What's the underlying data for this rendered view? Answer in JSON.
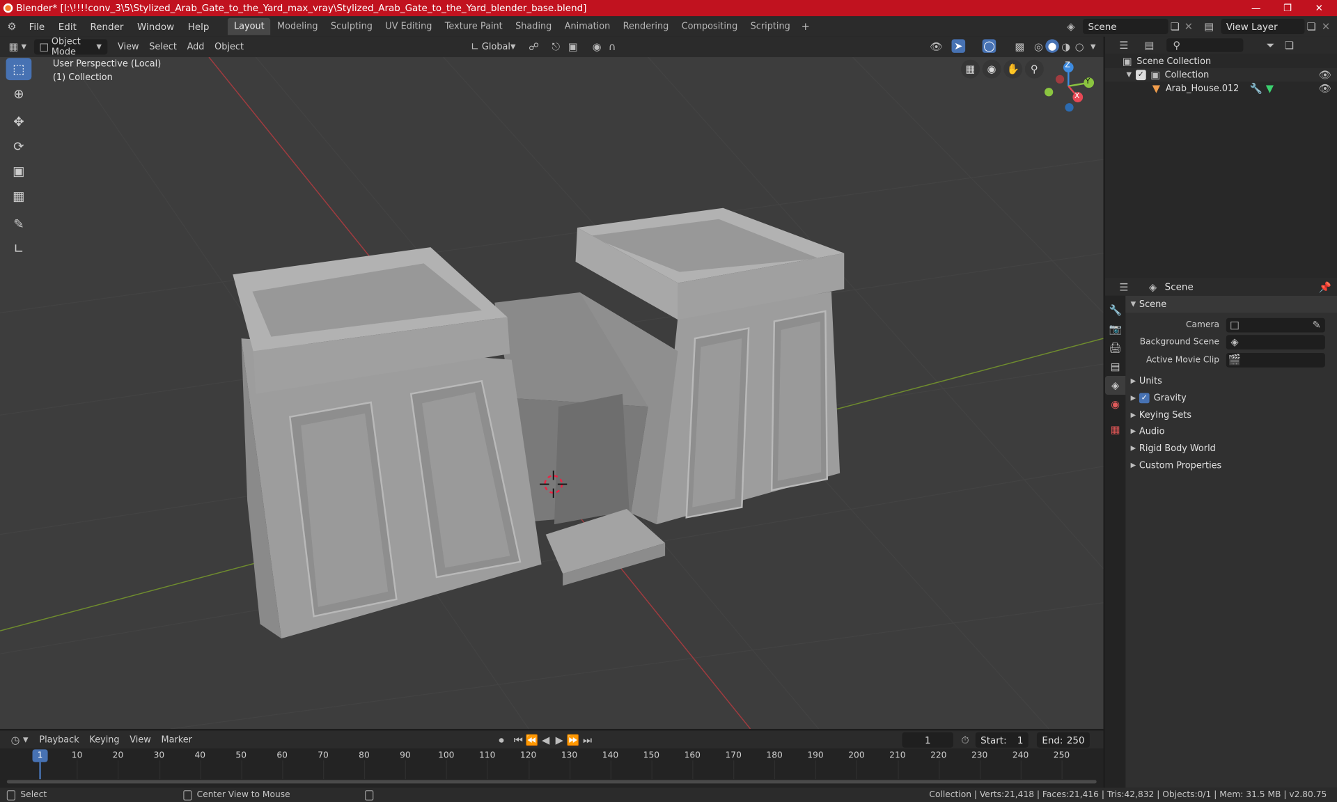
{
  "title_bar": {
    "title": "Blender* [I:\\!!!!conv_3\\5\\Stylized_Arab_Gate_to_the_Yard_max_vray\\Stylized_Arab_Gate_to_the_Yard_blender_base.blend]"
  },
  "menu": [
    "File",
    "Edit",
    "Render",
    "Window",
    "Help"
  ],
  "workspaces": [
    "Layout",
    "Modeling",
    "Sculpting",
    "UV Editing",
    "Texture Paint",
    "Shading",
    "Animation",
    "Rendering",
    "Compositing",
    "Scripting"
  ],
  "active_workspace": "Layout",
  "scene_selector": "Scene",
  "view_layer": "View Layer",
  "viewport_header": {
    "mode": "Object Mode",
    "menus": [
      "View",
      "Select",
      "Add",
      "Object"
    ],
    "transform_orientation": "Global"
  },
  "viewport": {
    "perspective": "User Perspective (Local)",
    "collection": "(1) Collection",
    "gizmo_axes": {
      "x": "X",
      "y": "Y",
      "z": "Z"
    }
  },
  "outliner": {
    "root": "Scene Collection",
    "collection": "Collection",
    "object": "Arab_House.012"
  },
  "properties": {
    "context": "Scene",
    "section": "Scene",
    "fields": {
      "camera": "Camera",
      "background_scene": "Background Scene",
      "active_movie_clip": "Active Movie Clip"
    },
    "panels": [
      "Units",
      "Gravity",
      "Keying Sets",
      "Audio",
      "Rigid Body World",
      "Custom Properties"
    ],
    "gravity_checked": true
  },
  "timeline": {
    "menus": [
      "Playback",
      "Keying",
      "View",
      "Marker"
    ],
    "current_frame": "1",
    "start_label": "Start:",
    "start": "1",
    "end_label": "End:",
    "end": "250",
    "ruler": [
      1,
      10,
      20,
      30,
      40,
      50,
      60,
      70,
      80,
      90,
      100,
      110,
      120,
      130,
      140,
      150,
      160,
      170,
      180,
      190,
      200,
      210,
      220,
      230,
      240,
      250
    ]
  },
  "status_bar": {
    "select": "Select",
    "center_view": "Center View to Mouse",
    "stats": "Collection | Verts:21,418 | Faces:21,416 | Tris:42,832 | Objects:0/1 | Mem: 31.5 MB | v2.80.75"
  },
  "colors": {
    "title_bar": "#c1121f",
    "accent": "#4772b3",
    "axis_x": "#e84855",
    "axis_y": "#8bc540",
    "axis_z": "#3d8be0"
  }
}
